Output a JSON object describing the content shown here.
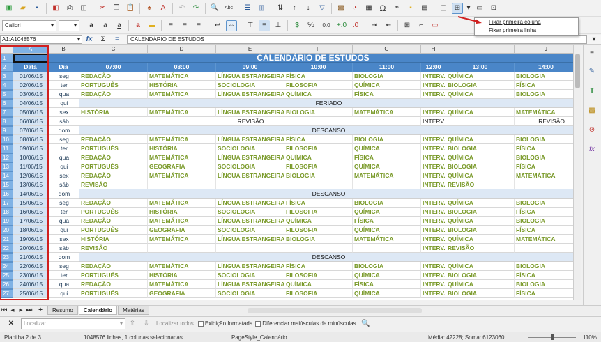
{
  "toolbar": {
    "font_name": "Calibri",
    "font_size": "",
    "percent_symbol": "%",
    "decimal_format": "0.0"
  },
  "formula_bar": {
    "name_box": "A1:A1048576",
    "content": "CALENDÁRIO DE ESTUDOS"
  },
  "freeze_menu": {
    "items": [
      "Fixar primeira coluna",
      "Fixar primeira linha"
    ]
  },
  "sheet": {
    "col_headers": [
      "A",
      "B",
      "C",
      "D",
      "E",
      "F",
      "G",
      "H",
      "I",
      "J"
    ],
    "title": "CALENDÁRIO DE ESTUDOS",
    "header_row": [
      "Data",
      "Dia",
      "07:00",
      "08:00",
      "09:00",
      "10:00",
      "11:00",
      "12:00",
      "13:00",
      "14:00"
    ],
    "rows": [
      {
        "n": "3",
        "date": "01/06/15",
        "day": "seg",
        "cells": [
          "REDAÇÃO",
          "MATEMÁTICA",
          "LÍNGUA ESTRANGEIRA",
          "FÍSICA",
          "BIOLOGIA",
          "INTERV.",
          "QUÍMICA",
          "BIOLOGIA"
        ]
      },
      {
        "n": "4",
        "date": "02/06/15",
        "day": "ter",
        "cells": [
          "PORTUGUÊS",
          "HISTÓRIA",
          "SOCIOLOGIA",
          "FILOSOFIA",
          "QUÍMICA",
          "INTERV.",
          "BIOLOGIA",
          "FÍSICA"
        ]
      },
      {
        "n": "5",
        "date": "03/06/15",
        "day": "qua",
        "cells": [
          "REDAÇÃO",
          "MATEMÁTICA",
          "LÍNGUA ESTRANGEIRA",
          "QUÍMICA",
          "FÍSICA",
          "INTERV.",
          "QUÍMICA",
          "BIOLOGIA"
        ]
      },
      {
        "n": "6",
        "date": "04/06/15",
        "day": "qui",
        "band": "FERIADO"
      },
      {
        "n": "7",
        "date": "05/06/15",
        "day": "sex",
        "cells": [
          "HISTÓRIA",
          "MATEMÁTICA",
          "LÍNGUA ESTRANGEIRA",
          "BIOLOGIA",
          "MATEMÁTICA",
          "INTERV.",
          "QUÍMICA",
          "MATEMÁTICA"
        ]
      },
      {
        "n": "8",
        "date": "06/06/15",
        "day": "sáb",
        "revisao": [
          "REVISÃO",
          "INTERV.",
          "REVISÃO"
        ]
      },
      {
        "n": "9",
        "date": "07/06/15",
        "day": "dom",
        "band": "DESCANSO"
      },
      {
        "n": "10",
        "date": "08/06/15",
        "day": "seg",
        "cells": [
          "REDAÇÃO",
          "MATEMÁTICA",
          "LÍNGUA ESTRANGEIRA",
          "FÍSICA",
          "BIOLOGIA",
          "INTERV.",
          "QUÍMICA",
          "BIOLOGIA"
        ]
      },
      {
        "n": "11",
        "date": "09/06/15",
        "day": "ter",
        "cells": [
          "PORTUGUÊS",
          "HISTÓRIA",
          "SOCIOLOGIA",
          "FILOSOFIA",
          "QUÍMICA",
          "INTERV.",
          "BIOLOGIA",
          "FÍSICA"
        ]
      },
      {
        "n": "12",
        "date": "10/06/15",
        "day": "qua",
        "cells": [
          "REDAÇÃO",
          "MATEMÁTICA",
          "LÍNGUA ESTRANGEIRA",
          "QUÍMICA",
          "FÍSICA",
          "INTERV.",
          "QUÍMICA",
          "BIOLOGIA"
        ]
      },
      {
        "n": "13",
        "date": "11/06/15",
        "day": "qui",
        "cells": [
          "PORTUGUÊS",
          "GEOGRAFIA",
          "SOCIOLOGIA",
          "FILOSOFIA",
          "QUÍMICA",
          "INTERV.",
          "BIOLOGIA",
          "FÍSICA"
        ]
      },
      {
        "n": "14",
        "date": "12/06/15",
        "day": "sex",
        "cells": [
          "REDAÇÃO",
          "MATEMÁTICA",
          "LÍNGUA ESTRANGEIRA",
          "BIOLOGIA",
          "MATEMÁTICA",
          "INTERV.",
          "QUÍMICA",
          "MATEMÁTICA"
        ]
      },
      {
        "n": "15",
        "date": "13/06/15",
        "day": "sáb",
        "cells": [
          "REVISÃO",
          "",
          "",
          "",
          "",
          "INTERV.",
          "REVISÃO",
          ""
        ]
      },
      {
        "n": "16",
        "date": "14/06/15",
        "day": "dom",
        "band": "DESCANSO"
      },
      {
        "n": "17",
        "date": "15/06/15",
        "day": "seg",
        "cells": [
          "REDAÇÃO",
          "MATEMÁTICA",
          "LÍNGUA ESTRANGEIRA",
          "FÍSICA",
          "BIOLOGIA",
          "INTERV.",
          "QUÍMICA",
          "BIOLOGIA"
        ]
      },
      {
        "n": "18",
        "date": "16/06/15",
        "day": "ter",
        "cells": [
          "PORTUGUÊS",
          "HISTÓRIA",
          "SOCIOLOGIA",
          "FILOSOFIA",
          "QUÍMICA",
          "INTERV.",
          "BIOLOGIA",
          "FÍSICA"
        ]
      },
      {
        "n": "19",
        "date": "17/06/15",
        "day": "qua",
        "cells": [
          "REDAÇÃO",
          "MATEMÁTICA",
          "LÍNGUA ESTRANGEIRA",
          "QUÍMICA",
          "FÍSICA",
          "INTERV.",
          "QUÍMICA",
          "BIOLOGIA"
        ]
      },
      {
        "n": "20",
        "date": "18/06/15",
        "day": "qui",
        "cells": [
          "PORTUGUÊS",
          "GEOGRAFIA",
          "SOCIOLOGIA",
          "FILOSOFIA",
          "QUÍMICA",
          "INTERV.",
          "BIOLOGIA",
          "FÍSICA"
        ]
      },
      {
        "n": "21",
        "date": "19/06/15",
        "day": "sex",
        "cells": [
          "HISTÓRIA",
          "MATEMÁTICA",
          "LÍNGUA ESTRANGEIRA",
          "BIOLOGIA",
          "MATEMÁTICA",
          "INTERV.",
          "QUÍMICA",
          "MATEMÁTICA"
        ]
      },
      {
        "n": "22",
        "date": "20/06/15",
        "day": "sáb",
        "cells": [
          "REVISÃO",
          "",
          "",
          "",
          "",
          "INTERV.",
          "REVISÃO",
          ""
        ]
      },
      {
        "n": "23",
        "date": "21/06/15",
        "day": "dom",
        "band": "DESCANSO"
      },
      {
        "n": "24",
        "date": "22/06/15",
        "day": "seg",
        "cells": [
          "REDAÇÃO",
          "MATEMÁTICA",
          "LÍNGUA ESTRANGEIRA",
          "FÍSICA",
          "BIOLOGIA",
          "INTERV.",
          "QUÍMICA",
          "BIOLOGIA"
        ]
      },
      {
        "n": "25",
        "date": "23/06/15",
        "day": "ter",
        "cells": [
          "PORTUGUÊS",
          "HISTÓRIA",
          "SOCIOLOGIA",
          "FILOSOFIA",
          "QUÍMICA",
          "INTERV.",
          "BIOLOGIA",
          "FÍSICA"
        ]
      },
      {
        "n": "26",
        "date": "24/06/15",
        "day": "qua",
        "cells": [
          "REDAÇÃO",
          "MATEMÁTICA",
          "LÍNGUA ESTRANGEIRA",
          "QUÍMICA",
          "FÍSICA",
          "INTERV.",
          "QUÍMICA",
          "BIOLOGIA"
        ]
      },
      {
        "n": "27",
        "date": "25/06/15",
        "day": "qui",
        "cells": [
          "PORTUGUÊS",
          "GEOGRAFIA",
          "SOCIOLOGIA",
          "FILOSOFIA",
          "QUÍMICA",
          "INTERV.",
          "BIOLOGIA",
          "FÍSICA"
        ]
      }
    ]
  },
  "tabs": [
    "Resumo",
    "Calendário",
    "Matérias"
  ],
  "find_bar": {
    "placeholder": "Localizar",
    "find_all": "Localizar todos",
    "formatted": "Exibição formatada",
    "match_case": "Diferenciar maiúsculas de minúsculas"
  },
  "status": {
    "sheet": "Planilha 2 de 3",
    "selection": "1048576 linhas, 1 colunas selecionadas",
    "style": "PageStyle_Calendário",
    "stats": "Média: 42228; Soma: 6123060",
    "zoom": "110%"
  }
}
